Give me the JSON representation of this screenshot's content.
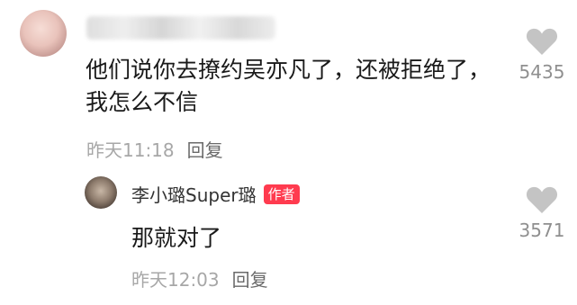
{
  "comment": {
    "text": "他们说你去撩约吴亦凡了，还被拒绝了，我怎么不信",
    "time": "昨天11:18",
    "reply_label": "回复",
    "likes": "5435"
  },
  "reply": {
    "username": "李小璐Super璐",
    "badge": "作者",
    "text": "那就对了",
    "time": "昨天12:03",
    "reply_label": "回复",
    "likes": "3571"
  },
  "colors": {
    "badge": "#ff3b4f",
    "heart": "#c4c4c4"
  },
  "icons": {
    "like": "heart-icon"
  }
}
